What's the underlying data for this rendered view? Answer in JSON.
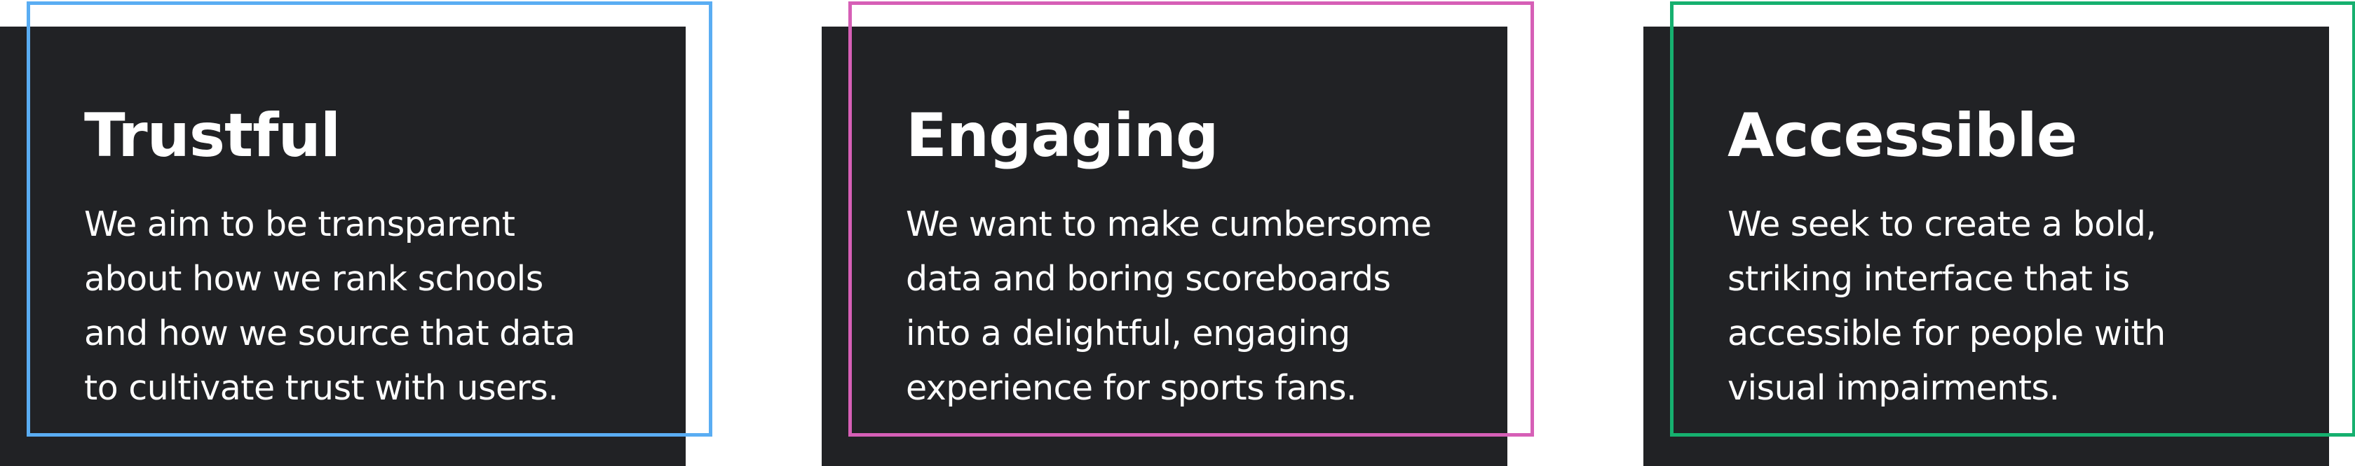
{
  "cards": [
    {
      "title": "Trustful",
      "lines": [
        "We aim to be transparent",
        "about how we rank schools",
        "and how we source that data",
        "to cultivate trust with users."
      ],
      "accent_color": "#5aadf3"
    },
    {
      "title": "Engaging",
      "lines": [
        "We want to make cumbersome",
        "data and boring scoreboards",
        "into a delightful, engaging",
        "experience for sports fans."
      ],
      "accent_color": "#d65fb6"
    },
    {
      "title": "Accessible",
      "lines": [
        "We seek to create a bold,",
        "striking interface that is",
        "accessible for people with",
        "visual impairments."
      ],
      "accent_color": "#16b06f"
    }
  ],
  "card_background": "#212225",
  "text_color": "#ffffff"
}
